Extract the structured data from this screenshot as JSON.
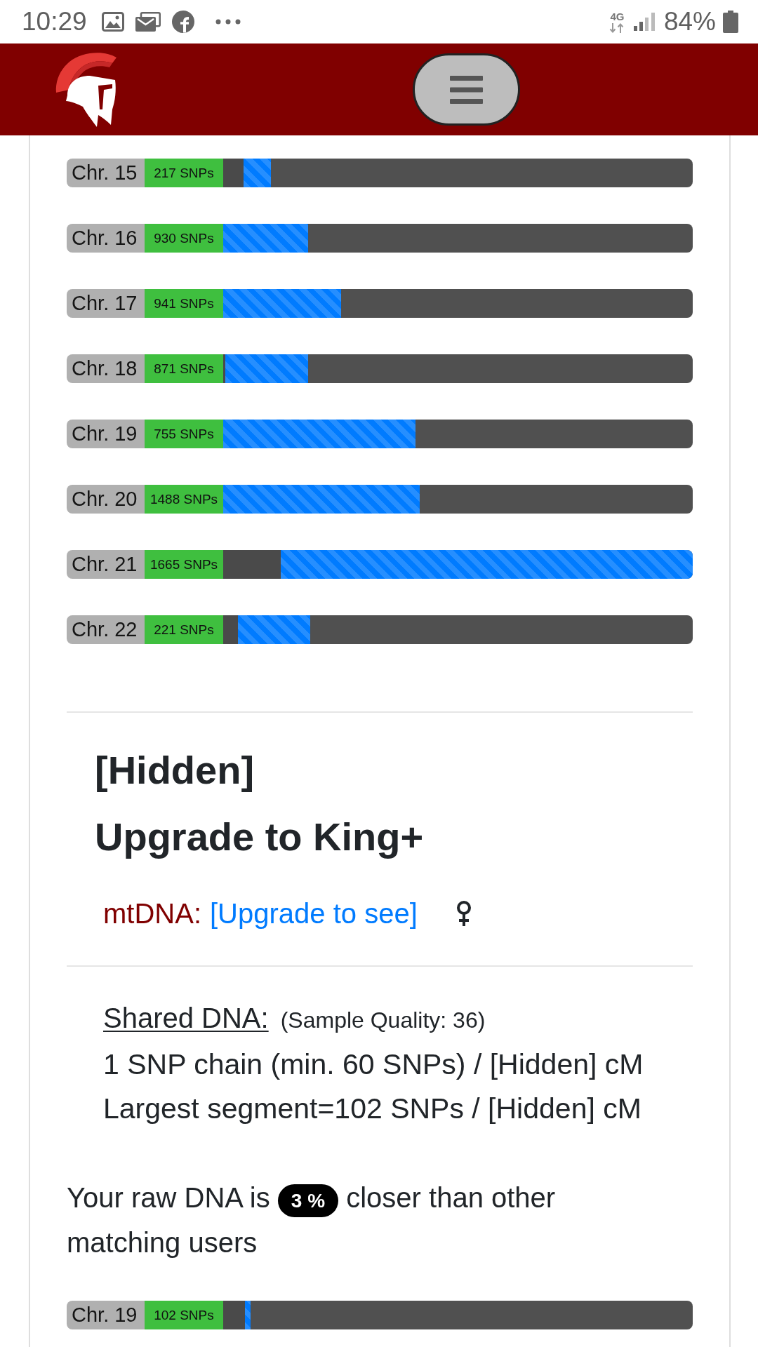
{
  "status_bar": {
    "time": "10:29",
    "network": "4G",
    "battery": "84%"
  },
  "chromosomes": [
    {
      "label": "Chr. 15",
      "snps": "217 SNPs",
      "offset": {
        "level": 0.044
      },
      "segment": {
        "level": 0.058
      }
    },
    {
      "label": "Chr. 16",
      "snps": "930 SNPs",
      "segment": {
        "level": 0.181
      }
    },
    {
      "label": "Chr. 17",
      "snps": "941 SNPs",
      "segment": {
        "level": 0.251
      }
    },
    {
      "label": "Chr. 18",
      "snps": "871 SNPs",
      "offset": {
        "level": 0.004
      },
      "segment": {
        "level": 0.177
      }
    },
    {
      "label": "Chr. 19",
      "snps": "755 SNPs",
      "segment": {
        "level": 0.41
      }
    },
    {
      "label": "Chr. 20",
      "snps": "1488 SNPs",
      "segment": {
        "level": 0.419
      }
    },
    {
      "label": "Chr. 21",
      "snps": "1665 SNPs",
      "offset": {
        "level": 0.123
      },
      "segment": {
        "level": 0.877
      }
    },
    {
      "label": "Chr. 22",
      "snps": "221 SNPs",
      "offset": {
        "level": 0.032
      },
      "segment": {
        "level": 0.153
      }
    }
  ],
  "match_profile": {
    "name": "[Hidden]",
    "upgrade_prompt": "Upgrade to King+",
    "mtdna": {
      "label": "mtDNA:",
      "link": "[Upgrade to see]"
    }
  },
  "shared_dna": {
    "title": "Shared DNA:",
    "quality": "(Sample Quality: 36)",
    "lines": [
      "1 SNP chain (min. 60 SNPs) / [Hidden] cM",
      "Largest segment=102 SNPs / [Hidden] cM"
    ]
  },
  "closeness": {
    "before": "Your raw DNA is",
    "badge": "3 %",
    "after": "closer than other matching users"
  },
  "shared_segments": [
    {
      "label": "Chr. 19",
      "snps": "102 SNPs",
      "offset": {
        "level": 0.046
      },
      "segment": {
        "level": 0.013
      }
    }
  ]
}
